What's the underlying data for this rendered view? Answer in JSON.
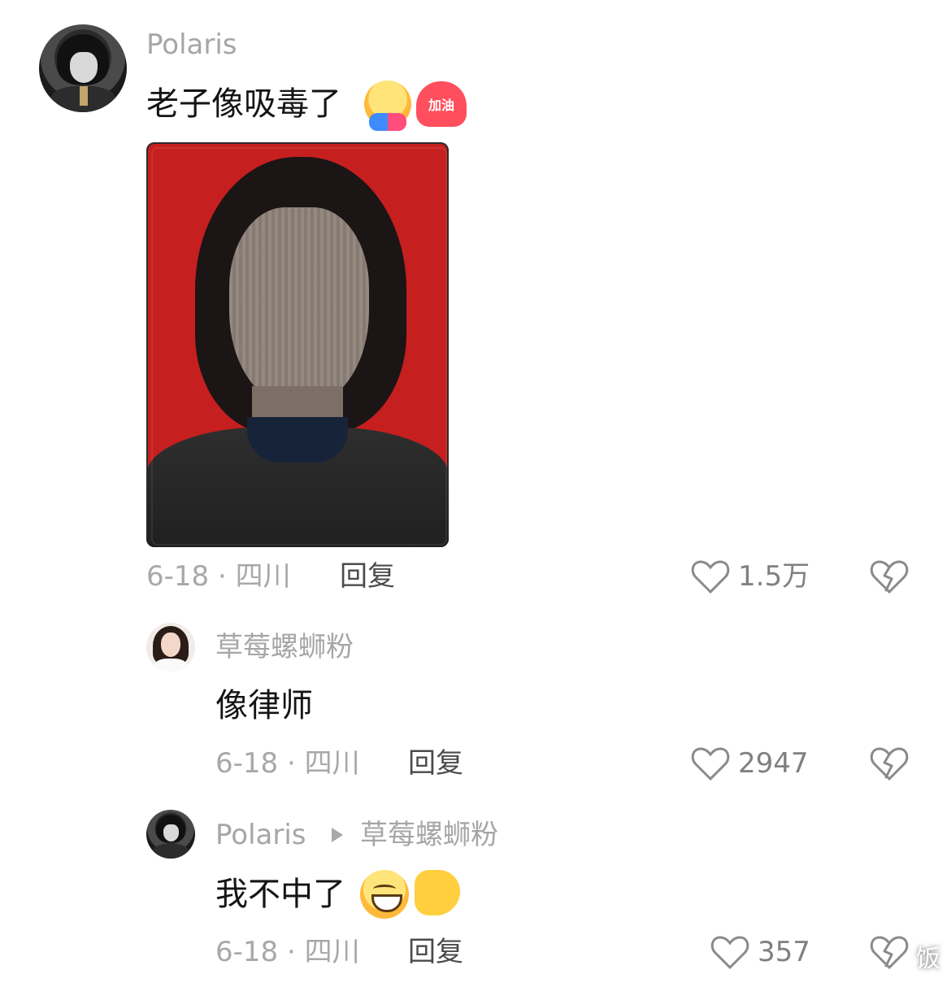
{
  "comments": [
    {
      "username": "Polaris",
      "content": "老子像吸毒了",
      "emojis": [
        "hugging-face",
        "heart-with-text"
      ],
      "heart_text": "加油",
      "meta": "6-18 · 四川",
      "reply": "回复",
      "likes": "1.5万"
    },
    {
      "username": "草莓螺蛳粉",
      "content": "像律师",
      "meta": "6-18 · 四川",
      "reply": "回复",
      "likes": "2947"
    },
    {
      "username": "Polaris",
      "target": "草莓螺蛳粉",
      "content": "我不中了",
      "emojis": [
        "grinning-face",
        "flexed-biceps"
      ],
      "meta": "6-18 · 四川",
      "reply": "回复",
      "likes": "357"
    }
  ],
  "icons": {
    "like": "heart-outline-icon",
    "dislike": "broken-heart-icon",
    "reply_arrow": "triangle-right-icon"
  },
  "watermark": "饭"
}
